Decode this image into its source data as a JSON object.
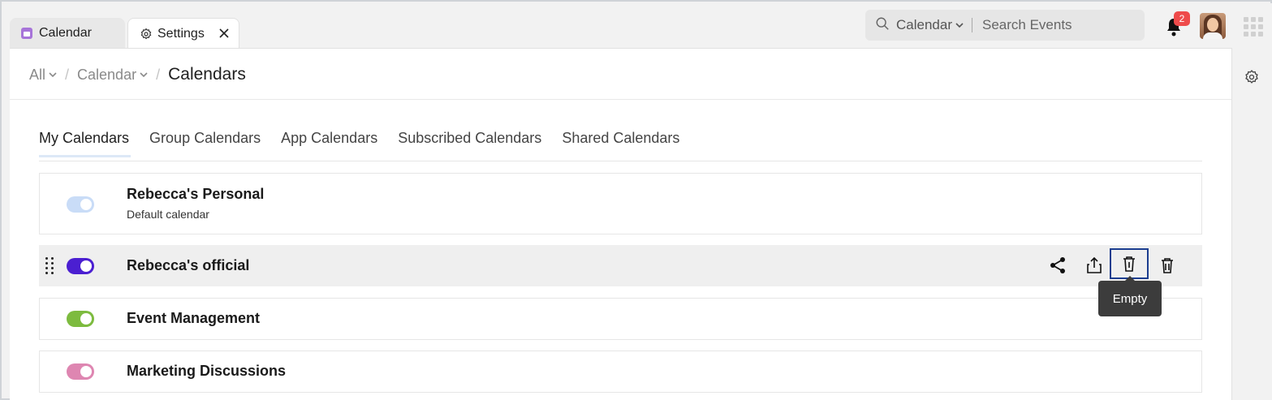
{
  "tabs": {
    "calendar_label": "Calendar",
    "settings_label": "Settings"
  },
  "search": {
    "scope": "Calendar",
    "placeholder": "Search Events"
  },
  "notifications": {
    "count": "2"
  },
  "breadcrumb": {
    "root": "All",
    "app": "Calendar",
    "current": "Calendars"
  },
  "section_tabs": [
    {
      "label": "My Calendars",
      "active": true
    },
    {
      "label": "Group Calendars"
    },
    {
      "label": "App Calendars"
    },
    {
      "label": "Subscribed Calendars"
    },
    {
      "label": "Shared Calendars"
    }
  ],
  "calendars": [
    {
      "name": "Rebecca's Personal",
      "subtitle": "Default calendar",
      "color": "#c9dcf7",
      "enabled": true
    },
    {
      "name": "Rebecca's official",
      "color": "#4b1fd1",
      "enabled": true
    },
    {
      "name": "Event Management",
      "color": "#7dbb3f",
      "enabled": true
    },
    {
      "name": "Marketing Discussions",
      "color": "#de86b1",
      "enabled": true
    }
  ],
  "tooltip": "Empty",
  "icons": [
    "search-icon",
    "chevron-down-icon",
    "gear-icon",
    "close-icon",
    "bell-icon",
    "apps-grid-icon",
    "share-icon",
    "export-icon",
    "empty-trash-icon",
    "delete-icon",
    "drag-handle-icon"
  ]
}
